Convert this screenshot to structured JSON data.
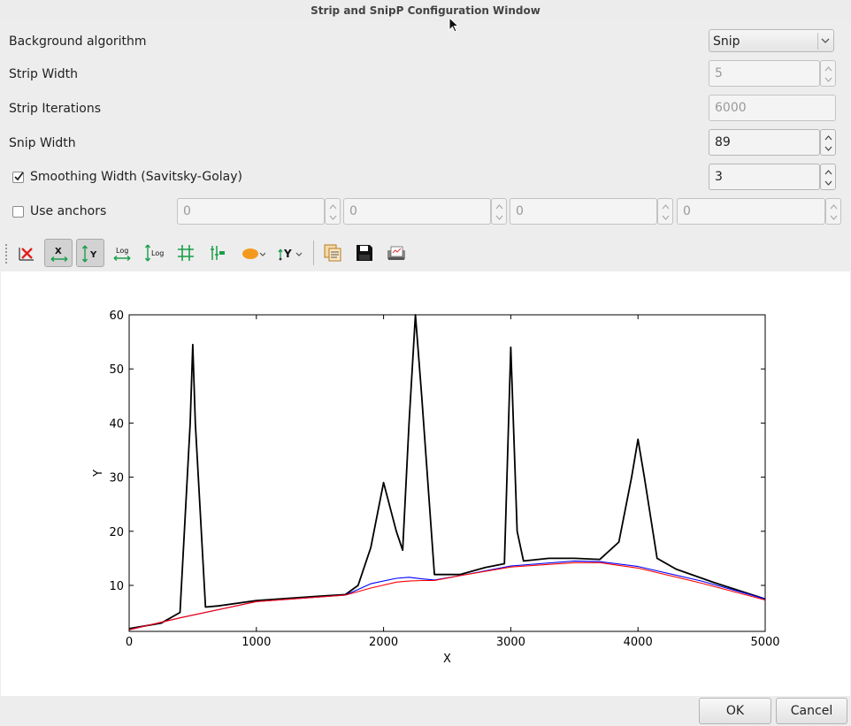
{
  "window": {
    "title": "Strip and SnipP Configuration Window"
  },
  "form": {
    "background_algorithm": {
      "label": "Background algorithm",
      "value": "Snip"
    },
    "strip_width": {
      "label": "Strip Width",
      "value": "5"
    },
    "strip_iterations": {
      "label": "Strip Iterations",
      "value": "6000"
    },
    "snip_width": {
      "label": "Snip Width",
      "value": "89"
    },
    "smoothing_width": {
      "label": "Smoothing Width (Savitsky-Golay)",
      "value": "3",
      "checked": true
    },
    "anchors": {
      "label": "Use anchors",
      "checked": false,
      "values": [
        "0",
        "0",
        "0",
        "0"
      ]
    }
  },
  "toolbar": {
    "icons": [
      "reset-zoom-icon",
      "x-autoscale-icon",
      "y-autoscale-icon",
      "x-log-icon",
      "y-log-icon",
      "grid-icon",
      "crosshair-icon",
      "symbol-icon",
      "y-axis-direction-icon",
      "copy-icon",
      "save-icon",
      "print-icon"
    ]
  },
  "chart_data": {
    "type": "line",
    "xlabel": "X",
    "ylabel": "Y",
    "xlim": [
      0,
      5000
    ],
    "ylim": [
      1.5,
      60
    ],
    "xticks": [
      "0",
      "1000",
      "2000",
      "3000",
      "4000",
      "5000"
    ],
    "yticks": [
      "10",
      "20",
      "30",
      "40",
      "50",
      "60"
    ],
    "series": [
      {
        "color": "#000000",
        "x": [
          0,
          250,
          400,
          480,
          500,
          520,
          600,
          700,
          1000,
          1500,
          1700,
          1800,
          1900,
          2000,
          2100,
          2150,
          2200,
          2250,
          2300,
          2400,
          2600,
          2800,
          2950,
          3000,
          3050,
          3100,
          3300,
          3500,
          3700,
          3850,
          3950,
          4000,
          4050,
          4150,
          4300,
          4600,
          5000
        ],
        "y": [
          2,
          3,
          5,
          40,
          54.5,
          40,
          6,
          6.2,
          7.2,
          8,
          8.3,
          10,
          17,
          29,
          20,
          16.5,
          40,
          60,
          45,
          12,
          12,
          13.3,
          14,
          54,
          20,
          14.5,
          15,
          15,
          14.8,
          18,
          30,
          37,
          30,
          15,
          13,
          10.5,
          7.5
        ]
      },
      {
        "color": "#0000ff",
        "x": [
          0,
          400,
          1000,
          1700,
          1900,
          2100,
          2200,
          2300,
          2400,
          2600,
          3000,
          3500,
          3700,
          4000,
          4500,
          5000
        ],
        "y": [
          1.8,
          4,
          7,
          8.2,
          10.3,
          11.3,
          11.5,
          11.2,
          11,
          11.8,
          13.6,
          14.5,
          14.4,
          13.5,
          10.8,
          7.5
        ]
      },
      {
        "color": "#ff0000",
        "x": [
          0,
          400,
          1000,
          1700,
          1900,
          2100,
          2200,
          2300,
          2400,
          2600,
          3000,
          3500,
          3700,
          4000,
          4500,
          5000
        ],
        "y": [
          1.8,
          4,
          7,
          8.2,
          9.5,
          10.6,
          10.8,
          10.9,
          10.9,
          11.8,
          13.4,
          14.2,
          14.2,
          13.2,
          10.4,
          7.3
        ]
      }
    ]
  },
  "buttons": {
    "ok": "OK",
    "cancel": "Cancel"
  }
}
